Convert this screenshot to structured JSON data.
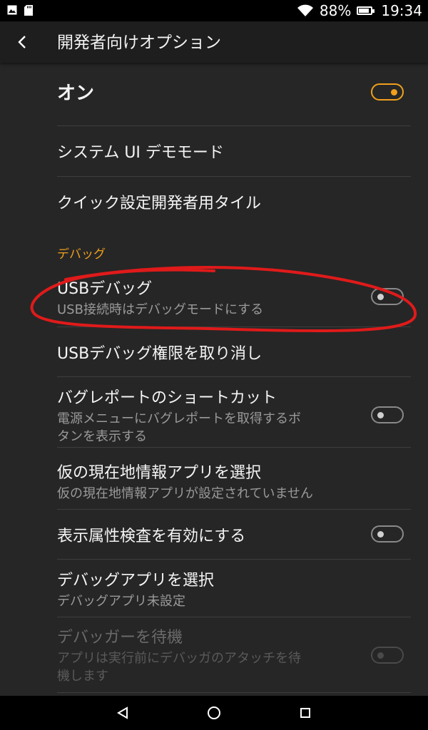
{
  "status_bar": {
    "battery": "88%",
    "time": "19:34",
    "battery_level": 0.88
  },
  "app_bar": {
    "title": "開発者向けオプション",
    "back_icon": "arrow-back-icon"
  },
  "master_switch": {
    "label": "オン",
    "on": true
  },
  "items": {
    "demo_mode": {
      "title": "システム UI デモモード"
    },
    "quick_tiles": {
      "title": "クイック設定開発者用タイル"
    },
    "section_debug": {
      "title": "デバッグ"
    },
    "usb_debugging": {
      "title": "USBデバッグ",
      "summary": "USB接続時はデバッグモードにする",
      "on": false
    },
    "revoke_usb": {
      "title": "USBデバッグ権限を取り消し"
    },
    "bugreport_shortcut": {
      "title": "バグレポートのショートカット",
      "summary_line1": "電源メニューにバグレポートを取得するボ",
      "summary_line2": "タンを表示する",
      "on": false
    },
    "mock_location": {
      "title": "仮の現在地情報アプリを選択",
      "summary": "仮の現在地情報アプリが設定されていません"
    },
    "view_attr": {
      "title": "表示属性検査を有効にする",
      "on": false
    },
    "debug_app": {
      "title": "デバッグアプリを選択",
      "summary": "デバッグアプリ未設定"
    },
    "wait_debugger": {
      "title": "デバッガーを待機",
      "summary_line1": "アプリは実行前にデバッガのアタッチを待",
      "summary_line2": "機します",
      "on": false,
      "enabled": false
    }
  },
  "colors": {
    "accent": "#f0a01c",
    "background": "#262626",
    "annotation": "#e01a1a"
  },
  "nav_bar": {
    "back_icon": "triangle-back-icon",
    "home_icon": "circle-home-icon",
    "recents_icon": "square-recents-icon"
  }
}
